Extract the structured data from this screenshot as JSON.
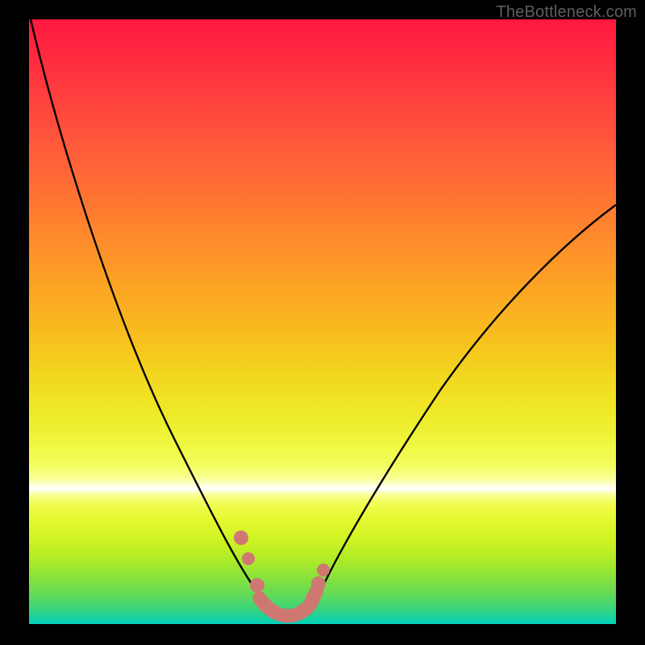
{
  "watermark": "TheBottleneck.com",
  "colors": {
    "curve_stroke": "#000000",
    "marker_fill": "#cf7871",
    "background": "#000000"
  },
  "chart_data": {
    "type": "line",
    "title": "",
    "xlabel": "",
    "ylabel": "",
    "xlim": [
      0,
      100
    ],
    "ylim": [
      0,
      100
    ],
    "grid": false,
    "legend": false,
    "note": "No axis ticks or numeric labels are rendered; values below are visual estimates on a 0–100 normalized scale where y=0 is the bottom green band and y=100 is the top red band.",
    "series": [
      {
        "name": "bottleneck-curve",
        "x": [
          0,
          5,
          10,
          15,
          20,
          25,
          30,
          35,
          38,
          40,
          42,
          44,
          46,
          48,
          50,
          55,
          60,
          65,
          70,
          75,
          80,
          85,
          90,
          95,
          100
        ],
        "y": [
          100,
          90,
          79,
          67,
          55,
          43,
          31,
          19,
          12,
          8,
          5,
          3,
          2,
          2,
          3,
          9,
          17,
          26,
          34,
          42,
          49,
          55,
          60,
          64,
          67
        ]
      }
    ],
    "markers": {
      "name": "highlighted-range",
      "visual": "thick salmon dots/segment near curve minimum",
      "points": [
        {
          "x": 36.5,
          "y": 14
        },
        {
          "x": 38.5,
          "y": 8
        },
        {
          "x": 40.0,
          "y": 4
        },
        {
          "x": 42.0,
          "y": 2.5
        },
        {
          "x": 44.0,
          "y": 2
        },
        {
          "x": 46.0,
          "y": 2.5
        },
        {
          "x": 47.5,
          "y": 4
        },
        {
          "x": 48.5,
          "y": 6
        },
        {
          "x": 49.5,
          "y": 9
        }
      ]
    },
    "gradient_bands_meaning": "vertical color gradient from red (high bottleneck) at top to green (no bottleneck) at bottom"
  }
}
